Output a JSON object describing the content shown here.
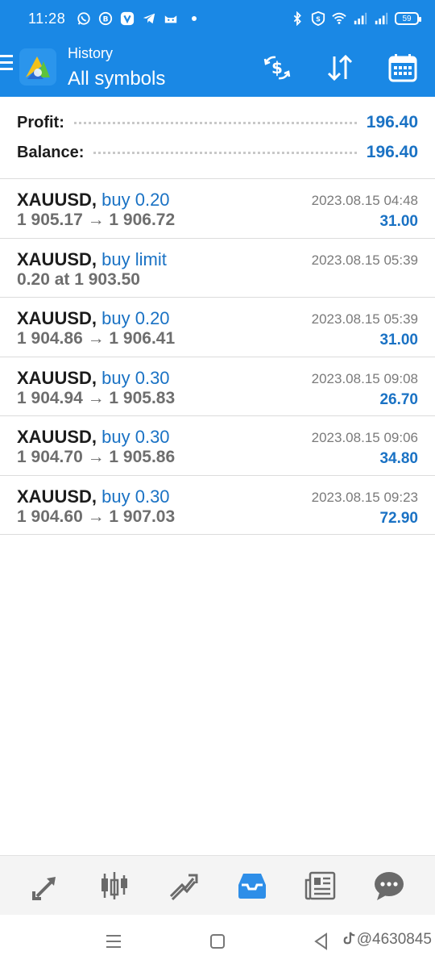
{
  "status_bar": {
    "time": "11:28",
    "battery": "59",
    "left_icons": [
      "whatsapp-icon",
      "b-icon",
      "vivaldi-icon",
      "telegram-icon",
      "cat-icon"
    ],
    "right_icons": [
      "bluetooth-icon",
      "s-icon",
      "wifi-icon",
      "signal-icon",
      "signal-icon-2"
    ]
  },
  "header": {
    "subtitle": "History",
    "title": "All symbols",
    "actions": [
      "currency-exchange-icon",
      "sort-icon",
      "calendar-icon"
    ]
  },
  "summary": {
    "profit_label": "Profit:",
    "profit_value": "196.40",
    "balance_label": "Balance:",
    "balance_value": "196.40"
  },
  "trades": [
    {
      "symbol": "XAUUSD,",
      "side": "buy 0.20",
      "prices": "1 905.17 → 1 906.72",
      "date": "2023.08.15 04:48",
      "profit": "31.00"
    },
    {
      "symbol": "XAUUSD,",
      "side": "buy limit",
      "prices": "0.20 at 1 903.50",
      "date": "2023.08.15 05:39",
      "profit": ""
    },
    {
      "symbol": "XAUUSD,",
      "side": "buy 0.20",
      "prices": "1 904.86 → 1 906.41",
      "date": "2023.08.15 05:39",
      "profit": "31.00"
    },
    {
      "symbol": "XAUUSD,",
      "side": "buy 0.30",
      "prices": "1 904.94 → 1 905.83",
      "date": "2023.08.15 09:08",
      "profit": "26.70"
    },
    {
      "symbol": "XAUUSD,",
      "side": "buy 0.30",
      "prices": "1 904.70 → 1 905.86",
      "date": "2023.08.15 09:06",
      "profit": "34.80"
    },
    {
      "symbol": "XAUUSD,",
      "side": "buy 0.30",
      "prices": "1 904.60 → 1 907.03",
      "date": "2023.08.15 09:23",
      "profit": "72.90"
    }
  ],
  "tabs": [
    {
      "icon": "quotes-icon",
      "active": false
    },
    {
      "icon": "chart-icon",
      "active": false
    },
    {
      "icon": "trade-icon",
      "active": false
    },
    {
      "icon": "history-icon",
      "active": true
    },
    {
      "icon": "news-icon",
      "active": false
    },
    {
      "icon": "chat-icon",
      "active": false
    }
  ],
  "nav": {
    "buttons": [
      "menu-nav-icon",
      "home-nav-icon",
      "back-nav-icon"
    ],
    "watermark": "@4630845"
  },
  "colors": {
    "primary": "#1a88e5",
    "accent_text": "#1a72c4",
    "tab_active": "#2e8ee8",
    "tab_inactive": "#6a6a6a"
  }
}
